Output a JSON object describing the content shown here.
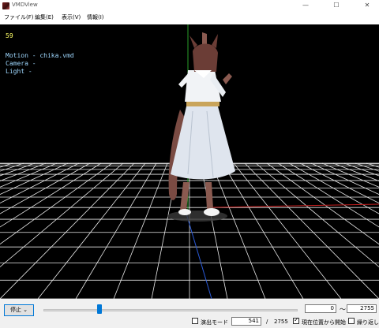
{
  "window": {
    "title": "VMDView",
    "minimize": "—",
    "maximize": "☐",
    "close": "✕"
  },
  "menu": {
    "items": [
      "ファイル(F)",
      "編集(E)",
      "表示(V)",
      "情報(I)"
    ]
  },
  "viewport": {
    "frame": "59",
    "motion_line": "Motion - chika.vmd",
    "camera_line": "Camera -",
    "light_line": "Light  -",
    "text_color": "#ffff66",
    "info_color": "#9fd8ff"
  },
  "controls": {
    "stop_label": "停止",
    "range_start": "0",
    "range_separator": "～",
    "range_end": "2755",
    "slider_fraction": 0.22,
    "demo_mode_label": "演出モード",
    "demo_mode_checked": false,
    "current_frame": "541",
    "frame_separator": "/",
    "total_frames": "2755",
    "start_from_current_label": "現在位置から開始",
    "start_from_current_checked": true,
    "loop_label": "繰り返し",
    "loop_checked": false
  }
}
